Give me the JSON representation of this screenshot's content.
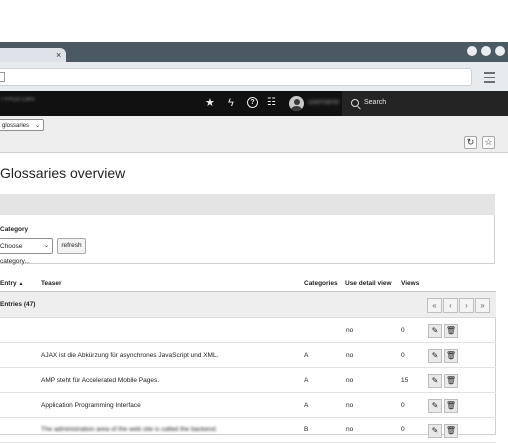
{
  "browser": {
    "tab_close": "×",
    "window_controls": [
      "minimize",
      "maximize",
      "close"
    ]
  },
  "appbar": {
    "brand": "TYPO3 CMS",
    "icons": [
      "star-icon",
      "bolt-icon",
      "help-icon",
      "list-icon"
    ],
    "username": "username",
    "search_label": "Search"
  },
  "module": {
    "select_value": "glossaries"
  },
  "page": {
    "title": "Glossaries overview"
  },
  "filter": {
    "label": "Category",
    "select_value": "Choose category...",
    "refresh_label": "refresh"
  },
  "table": {
    "columns": [
      "Entry",
      "Teaser",
      "Categories",
      "Use detail view",
      "Views"
    ],
    "group_label": "Entries (47)",
    "pager": [
      "«",
      "‹",
      "›",
      "»"
    ],
    "rows": [
      {
        "teaser": "",
        "categories": "",
        "detail": "no",
        "views": "0"
      },
      {
        "teaser": "AJAX ist die Abkürzung für asynchrones JavaScript und XML.",
        "categories": "A",
        "detail": "no",
        "views": "0"
      },
      {
        "teaser": "AMP steht für Accelerated Mobile Pages.",
        "categories": "A",
        "detail": "no",
        "views": "15"
      },
      {
        "teaser": "Application Programming Interface",
        "categories": "A",
        "detail": "no",
        "views": "0"
      },
      {
        "teaser": "The administration area of the web site is called the backend.",
        "categories": "B",
        "detail": "no",
        "views": "0"
      }
    ]
  },
  "colors": {
    "chrome": "#4b5962",
    "appbar": "#111111",
    "search_bg": "#242424"
  }
}
